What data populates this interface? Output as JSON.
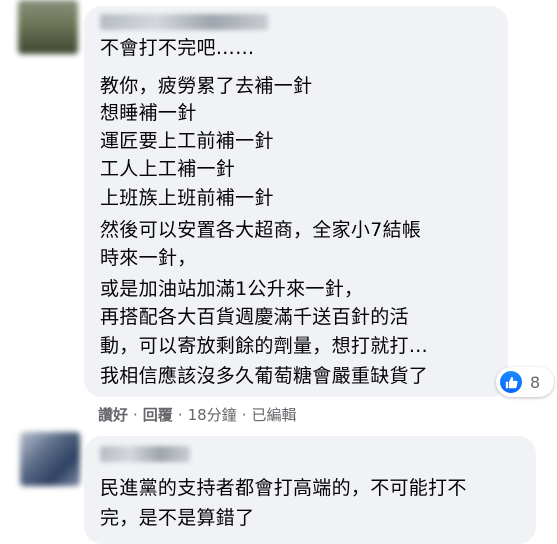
{
  "comments": [
    {
      "lines": [
        "不會打不完吧……",
        "教你，疲勞累了去補一針",
        "想睡補一針",
        "運匠要上工前補一針",
        "工人上工補一針",
        "上班族上班前補一針",
        "然後可以安置各大超商，全家小7結帳",
        "時來一針，",
        "或是加油站加滿1公升來一針，",
        "再搭配各大百貨週慶滿千送百針的活",
        "動，可以寄放剩餘的劑量，想打就打…",
        "我相信應該沒多久葡萄糖會嚴重缺貨了"
      ],
      "reaction": {
        "icon": "like-icon",
        "count": "8"
      },
      "actions": {
        "like": "讚好",
        "dot1": "·",
        "reply": "回覆",
        "dot2": "·",
        "time": "18分鐘",
        "dot3": "·",
        "edited": "已編輯"
      }
    },
    {
      "lines": [
        "民進黨的支持者都會打高端的，不可能打不",
        "完，是不是算錯了"
      ]
    }
  ],
  "colors": {
    "bubble": "#f0f2f5",
    "like": "#0866ff",
    "meta": "#65676b",
    "text": "#050505"
  }
}
